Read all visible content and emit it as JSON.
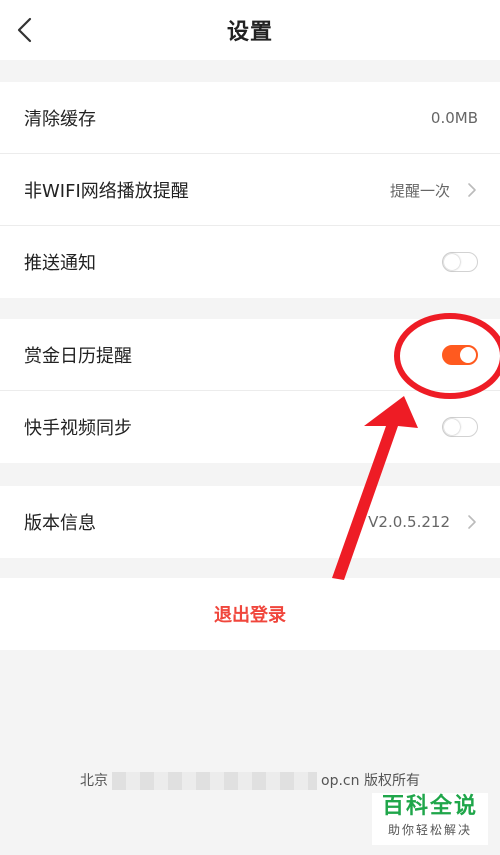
{
  "header": {
    "title": "设置"
  },
  "group1": {
    "clear_cache": {
      "label": "清除缓存",
      "value": "0.0MB"
    },
    "non_wifi": {
      "label": "非WIFI网络播放提醒",
      "value": "提醒一次"
    },
    "push": {
      "label": "推送通知",
      "state": "off"
    }
  },
  "group2": {
    "reward_calendar": {
      "label": "赏金日历提醒",
      "state": "on"
    },
    "kuaishou_sync": {
      "label": "快手视频同步",
      "state": "off"
    }
  },
  "group3": {
    "version": {
      "label": "版本信息",
      "value": "V2.0.5.212"
    }
  },
  "logout": {
    "label": "退出登录"
  },
  "footer": {
    "prefix": "北京",
    "suffix": "op.cn 版权所有"
  },
  "watermark": {
    "main": "百科全说",
    "sub": "助你轻松解决"
  },
  "colors": {
    "accent": "#ff5a1f",
    "logout": "#f0463c",
    "annotation": "#ee1c25",
    "watermark": "#1fa64a"
  }
}
